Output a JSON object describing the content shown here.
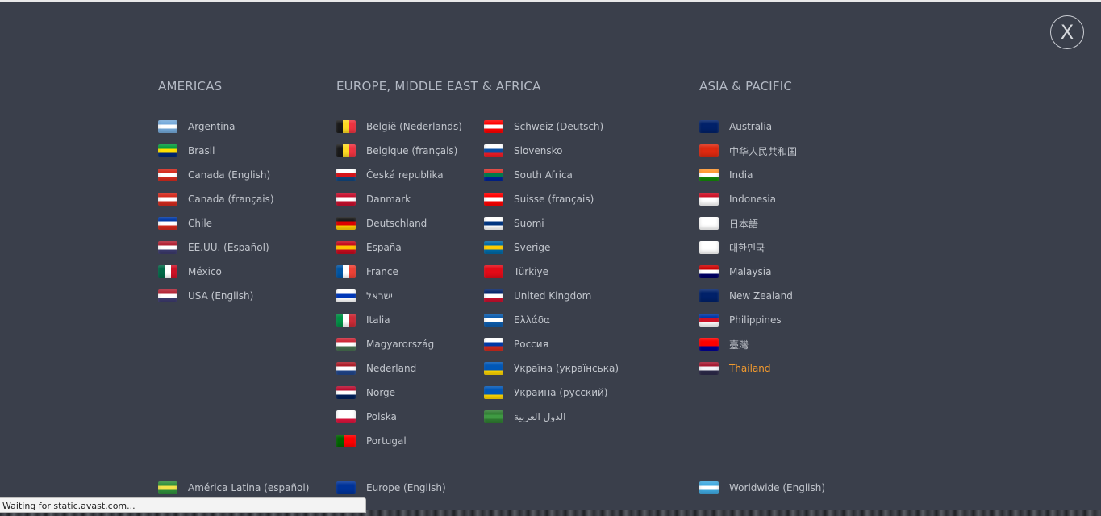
{
  "close_label": "X",
  "regions": [
    {
      "title": "AMERICAS",
      "columns": [
        [
          {
            "label": "Argentina",
            "flag": "argentina-flag-icon",
            "colors": [
              "#75aadb",
              "#ffffff",
              "#75aadb"
            ]
          },
          {
            "label": "Brasil",
            "flag": "brazil-flag-icon",
            "colors": [
              "#009c3b",
              "#ffdf00",
              "#002776"
            ]
          },
          {
            "label": "Canada (English)",
            "flag": "canada-flag-icon",
            "colors": [
              "#d52b1e",
              "#ffffff",
              "#d52b1e"
            ]
          },
          {
            "label": "Canada (français)",
            "flag": "canada-flag-icon",
            "colors": [
              "#d52b1e",
              "#ffffff",
              "#d52b1e"
            ]
          },
          {
            "label": "Chile",
            "flag": "chile-flag-icon",
            "colors": [
              "#0039a6",
              "#ffffff",
              "#d52b1e"
            ]
          },
          {
            "label": "EE.UU. (Español)",
            "flag": "usa-flag-icon",
            "colors": [
              "#b22234",
              "#ffffff",
              "#3c3b6e"
            ]
          },
          {
            "label": "México",
            "flag": "mexico-flag-icon",
            "colors": [
              "#006847",
              "#ffffff",
              "#ce1126"
            ]
          },
          {
            "label": "USA (English)",
            "flag": "usa-flag-icon",
            "colors": [
              "#b22234",
              "#ffffff",
              "#3c3b6e"
            ]
          }
        ]
      ]
    },
    {
      "title": "EUROPE, MIDDLE EAST & AFRICA",
      "columns": [
        [
          {
            "label": "België (Nederlands)",
            "flag": "belgium-flag-icon",
            "colors": [
              "#1a1a1a",
              "#fdda24",
              "#ef3340"
            ]
          },
          {
            "label": "Belgique (français)",
            "flag": "belgium-flag-icon",
            "colors": [
              "#1a1a1a",
              "#fdda24",
              "#ef3340"
            ]
          },
          {
            "label": "Česká republika",
            "flag": "czech-flag-icon",
            "colors": [
              "#ffffff",
              "#d7141a",
              "#11457e"
            ]
          },
          {
            "label": "Danmark",
            "flag": "denmark-flag-icon",
            "colors": [
              "#c8102e",
              "#ffffff",
              "#c8102e"
            ]
          },
          {
            "label": "Deutschland",
            "flag": "germany-flag-icon",
            "colors": [
              "#1a1a1a",
              "#dd0000",
              "#ffce00"
            ]
          },
          {
            "label": "España",
            "flag": "spain-flag-icon",
            "colors": [
              "#c60b1e",
              "#ffc400",
              "#c60b1e"
            ]
          },
          {
            "label": "France",
            "flag": "france-flag-icon",
            "colors": [
              "#0055a4",
              "#ffffff",
              "#ef4135"
            ]
          },
          {
            "label": "ישראל",
            "flag": "israel-flag-icon",
            "colors": [
              "#ffffff",
              "#0038b8",
              "#ffffff"
            ]
          },
          {
            "label": "Italia",
            "flag": "italy-flag-icon",
            "colors": [
              "#009246",
              "#ffffff",
              "#ce2b37"
            ]
          },
          {
            "label": "Magyarország",
            "flag": "hungary-flag-icon",
            "colors": [
              "#ce2939",
              "#ffffff",
              "#477050"
            ]
          },
          {
            "label": "Nederland",
            "flag": "netherlands-flag-icon",
            "colors": [
              "#ae1c28",
              "#ffffff",
              "#21468b"
            ]
          },
          {
            "label": "Norge",
            "flag": "norway-flag-icon",
            "colors": [
              "#ba0c2f",
              "#ffffff",
              "#00205b"
            ]
          },
          {
            "label": "Polska",
            "flag": "poland-flag-icon",
            "colors": [
              "#ffffff",
              "#ffffff",
              "#dc143c"
            ]
          },
          {
            "label": "Portugal",
            "flag": "portugal-flag-icon",
            "colors": [
              "#006600",
              "#ff0000",
              "#ff0000"
            ]
          }
        ],
        [
          {
            "label": "Schweiz (Deutsch)",
            "flag": "switzerland-flag-icon",
            "colors": [
              "#ff0000",
              "#ffffff",
              "#ff0000"
            ]
          },
          {
            "label": "Slovensko",
            "flag": "slovakia-flag-icon",
            "colors": [
              "#ffffff",
              "#0b4ea2",
              "#ee1c25"
            ]
          },
          {
            "label": "South Africa",
            "flag": "south-africa-flag-icon",
            "colors": [
              "#de3831",
              "#007a4d",
              "#002395"
            ]
          },
          {
            "label": "Suisse (français)",
            "flag": "switzerland-flag-icon",
            "colors": [
              "#ff0000",
              "#ffffff",
              "#ff0000"
            ]
          },
          {
            "label": "Suomi",
            "flag": "finland-flag-icon",
            "colors": [
              "#ffffff",
              "#003580",
              "#ffffff"
            ]
          },
          {
            "label": "Sverige",
            "flag": "sweden-flag-icon",
            "colors": [
              "#006aa7",
              "#fecc00",
              "#006aa7"
            ]
          },
          {
            "label": "Türkiye",
            "flag": "turkey-flag-icon",
            "colors": [
              "#e30a17",
              "#e30a17",
              "#e30a17"
            ]
          },
          {
            "label": "United Kingdom",
            "flag": "uk-flag-icon",
            "colors": [
              "#012169",
              "#ffffff",
              "#c8102e"
            ]
          },
          {
            "label": "Ελλάδα",
            "flag": "greece-flag-icon",
            "colors": [
              "#0d5eaf",
              "#ffffff",
              "#0d5eaf"
            ]
          },
          {
            "label": "Россия",
            "flag": "russia-flag-icon",
            "colors": [
              "#ffffff",
              "#0039a6",
              "#d52b1e"
            ]
          },
          {
            "label": "Україна (українська)",
            "flag": "ukraine-flag-icon",
            "colors": [
              "#0057b7",
              "#0057b7",
              "#ffd700"
            ]
          },
          {
            "label": "Украина (русский)",
            "flag": "ukraine-flag-icon",
            "colors": [
              "#0057b7",
              "#0057b7",
              "#ffd700"
            ]
          },
          {
            "label": "الدول العربية",
            "flag": "arab-league-flag-icon",
            "colors": [
              "#2f7d32",
              "#3f9a43",
              "#2f7d32"
            ]
          }
        ]
      ]
    },
    {
      "title": "ASIA & PACIFIC",
      "columns": [
        [
          {
            "label": "Australia",
            "flag": "australia-flag-icon",
            "colors": [
              "#012169",
              "#012169",
              "#012169"
            ]
          },
          {
            "label": "中华人民共和国",
            "flag": "china-flag-icon",
            "colors": [
              "#de2910",
              "#de2910",
              "#de2910"
            ]
          },
          {
            "label": "India",
            "flag": "india-flag-icon",
            "colors": [
              "#ff9933",
              "#ffffff",
              "#138808"
            ]
          },
          {
            "label": "Indonesia",
            "flag": "indonesia-flag-icon",
            "colors": [
              "#ce1126",
              "#ffffff",
              "#ffffff"
            ]
          },
          {
            "label": "日本語",
            "flag": "japan-flag-icon",
            "colors": [
              "#ffffff",
              "#ffffff",
              "#ffffff"
            ]
          },
          {
            "label": "대한민국",
            "flag": "korea-flag-icon",
            "colors": [
              "#ffffff",
              "#ffffff",
              "#ffffff"
            ]
          },
          {
            "label": "Malaysia",
            "flag": "malaysia-flag-icon",
            "colors": [
              "#cc0001",
              "#ffffff",
              "#010066"
            ]
          },
          {
            "label": "New Zealand",
            "flag": "new-zealand-flag-icon",
            "colors": [
              "#012169",
              "#012169",
              "#012169"
            ]
          },
          {
            "label": "Philippines",
            "flag": "philippines-flag-icon",
            "colors": [
              "#0038a8",
              "#ce1126",
              "#ffffff"
            ]
          },
          {
            "label": "臺灣",
            "flag": "taiwan-flag-icon",
            "colors": [
              "#fe0000",
              "#fe0000",
              "#000095"
            ]
          },
          {
            "label": "Thailand",
            "flag": "thailand-flag-icon",
            "colors": [
              "#a51931",
              "#f4f5f8",
              "#2d2a4a"
            ],
            "active": true
          }
        ]
      ]
    }
  ],
  "footer": [
    {
      "label": "América Latina (español)",
      "flag": "latin-america-flag-icon",
      "colors": [
        "#2f8f3a",
        "#f2e34a",
        "#2f8f3a"
      ]
    },
    {
      "label": "Europe (English)",
      "flag": "eu-flag-icon",
      "colors": [
        "#003399",
        "#003399",
        "#003399"
      ]
    },
    {
      "label": "Worldwide (English)",
      "flag": "globe-flag-icon",
      "colors": [
        "#3fa9e0",
        "#ffffff",
        "#3fa9e0"
      ]
    }
  ],
  "status_text": "Waiting for static.avast.com...",
  "accent_color": "#f29a2e"
}
